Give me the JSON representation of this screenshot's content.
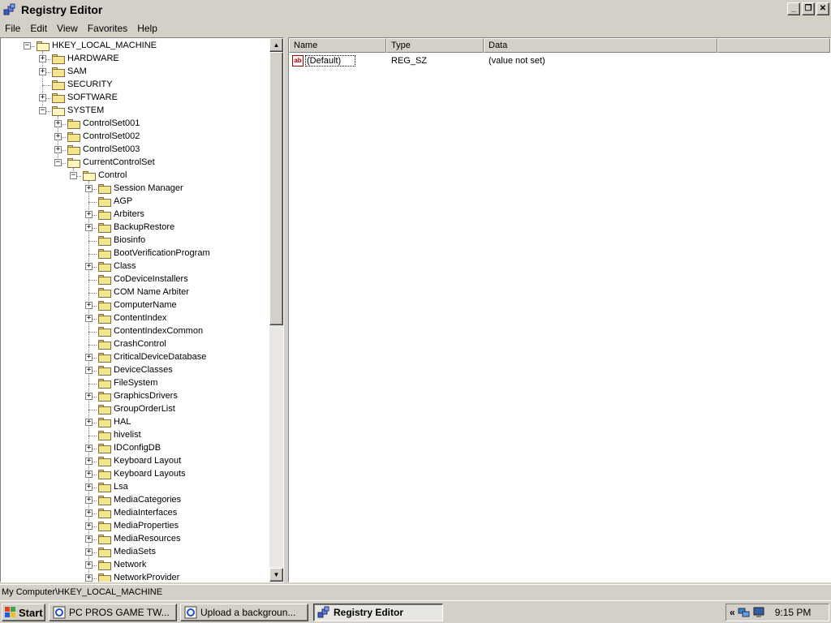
{
  "window": {
    "title": "Registry Editor",
    "buttons": {
      "minimize": "_",
      "restore": "❐",
      "close": "✕"
    }
  },
  "menu": [
    "File",
    "Edit",
    "View",
    "Favorites",
    "Help"
  ],
  "tree": {
    "nodes": [
      {
        "label": "HKEY_LOCAL_MACHINE",
        "depth": 0,
        "expander": "minus",
        "open": true
      },
      {
        "label": "HARDWARE",
        "depth": 1,
        "expander": "plus"
      },
      {
        "label": "SAM",
        "depth": 1,
        "expander": "plus"
      },
      {
        "label": "SECURITY",
        "depth": 1,
        "expander": "none"
      },
      {
        "label": "SOFTWARE",
        "depth": 1,
        "expander": "plus"
      },
      {
        "label": "SYSTEM",
        "depth": 1,
        "expander": "minus",
        "open": true
      },
      {
        "label": "ControlSet001",
        "depth": 2,
        "expander": "plus"
      },
      {
        "label": "ControlSet002",
        "depth": 2,
        "expander": "plus"
      },
      {
        "label": "ControlSet003",
        "depth": 2,
        "expander": "plus"
      },
      {
        "label": "CurrentControlSet",
        "depth": 2,
        "expander": "minus",
        "open": true
      },
      {
        "label": "Control",
        "depth": 3,
        "expander": "minus",
        "open": true
      },
      {
        "label": " Session Manager",
        "depth": 4,
        "expander": "plus"
      },
      {
        "label": "AGP",
        "depth": 4,
        "expander": "none"
      },
      {
        "label": "Arbiters",
        "depth": 4,
        "expander": "plus"
      },
      {
        "label": "BackupRestore",
        "depth": 4,
        "expander": "plus"
      },
      {
        "label": "Biosinfo",
        "depth": 4,
        "expander": "none"
      },
      {
        "label": "BootVerificationProgram",
        "depth": 4,
        "expander": "none"
      },
      {
        "label": "Class",
        "depth": 4,
        "expander": "plus"
      },
      {
        "label": "CoDeviceInstallers",
        "depth": 4,
        "expander": "none"
      },
      {
        "label": "COM Name Arbiter",
        "depth": 4,
        "expander": "none"
      },
      {
        "label": "ComputerName",
        "depth": 4,
        "expander": "plus"
      },
      {
        "label": "ContentIndex",
        "depth": 4,
        "expander": "plus"
      },
      {
        "label": "ContentIndexCommon",
        "depth": 4,
        "expander": "none"
      },
      {
        "label": "CrashControl",
        "depth": 4,
        "expander": "none"
      },
      {
        "label": "CriticalDeviceDatabase",
        "depth": 4,
        "expander": "plus"
      },
      {
        "label": "DeviceClasses",
        "depth": 4,
        "expander": "plus"
      },
      {
        "label": "FileSystem",
        "depth": 4,
        "expander": "none"
      },
      {
        "label": "GraphicsDrivers",
        "depth": 4,
        "expander": "plus"
      },
      {
        "label": "GroupOrderList",
        "depth": 4,
        "expander": "none"
      },
      {
        "label": "HAL",
        "depth": 4,
        "expander": "plus"
      },
      {
        "label": "hivelist",
        "depth": 4,
        "expander": "none"
      },
      {
        "label": "IDConfigDB",
        "depth": 4,
        "expander": "plus"
      },
      {
        "label": "Keyboard Layout",
        "depth": 4,
        "expander": "plus"
      },
      {
        "label": "Keyboard Layouts",
        "depth": 4,
        "expander": "plus"
      },
      {
        "label": "Lsa",
        "depth": 4,
        "expander": "plus"
      },
      {
        "label": "MediaCategories",
        "depth": 4,
        "expander": "plus"
      },
      {
        "label": "MediaInterfaces",
        "depth": 4,
        "expander": "plus"
      },
      {
        "label": "MediaProperties",
        "depth": 4,
        "expander": "plus"
      },
      {
        "label": "MediaResources",
        "depth": 4,
        "expander": "plus"
      },
      {
        "label": "MediaSets",
        "depth": 4,
        "expander": "plus"
      },
      {
        "label": "Network",
        "depth": 4,
        "expander": "plus"
      },
      {
        "label": "NetworkProvider",
        "depth": 4,
        "expander": "plus"
      }
    ]
  },
  "list": {
    "columns": [
      "Name",
      "Type",
      "Data"
    ],
    "rows": [
      {
        "icon": "ab",
        "name": "(Default)",
        "type": "REG_SZ",
        "data": "(value not set)"
      }
    ]
  },
  "status": "My Computer\\HKEY_LOCAL_MACHINE",
  "taskbar": {
    "start": "Start",
    "tasks": [
      {
        "label": "PC PROS GAME TW...",
        "icon": "ie-icon"
      },
      {
        "label": "Upload a backgroun...",
        "icon": "ie-icon"
      },
      {
        "label": "Registry Editor",
        "icon": "regedit-icon",
        "active": true
      }
    ],
    "tray": {
      "chevron": "«",
      "time": "9:15 PM"
    }
  }
}
